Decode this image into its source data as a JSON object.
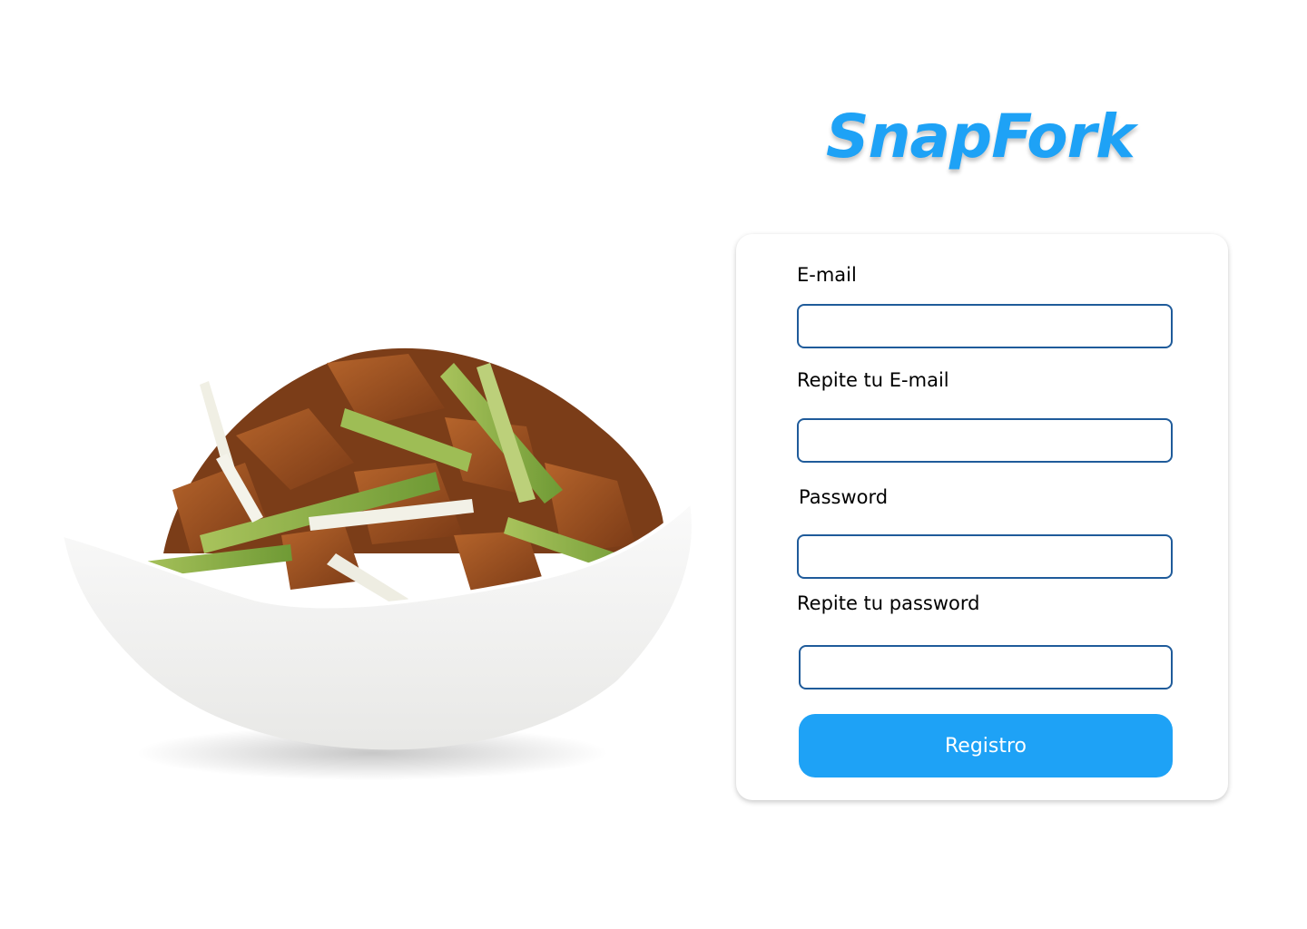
{
  "brand": {
    "title": "SnapFork",
    "color": "#1ea2f6"
  },
  "hero_image": {
    "icon": "food-bowl-illustration"
  },
  "form": {
    "fields": [
      {
        "label": "E-mail",
        "value": "",
        "placeholder": ""
      },
      {
        "label": "Repite tu E-mail",
        "value": "",
        "placeholder": ""
      },
      {
        "label": "Password",
        "value": "",
        "placeholder": ""
      },
      {
        "label": "Repite tu password",
        "value": "",
        "placeholder": ""
      }
    ],
    "submit_label": "Registro"
  },
  "colors": {
    "accent": "#1ea2f6",
    "input_border": "#1f5b9a",
    "card_background": "#ffffff"
  }
}
